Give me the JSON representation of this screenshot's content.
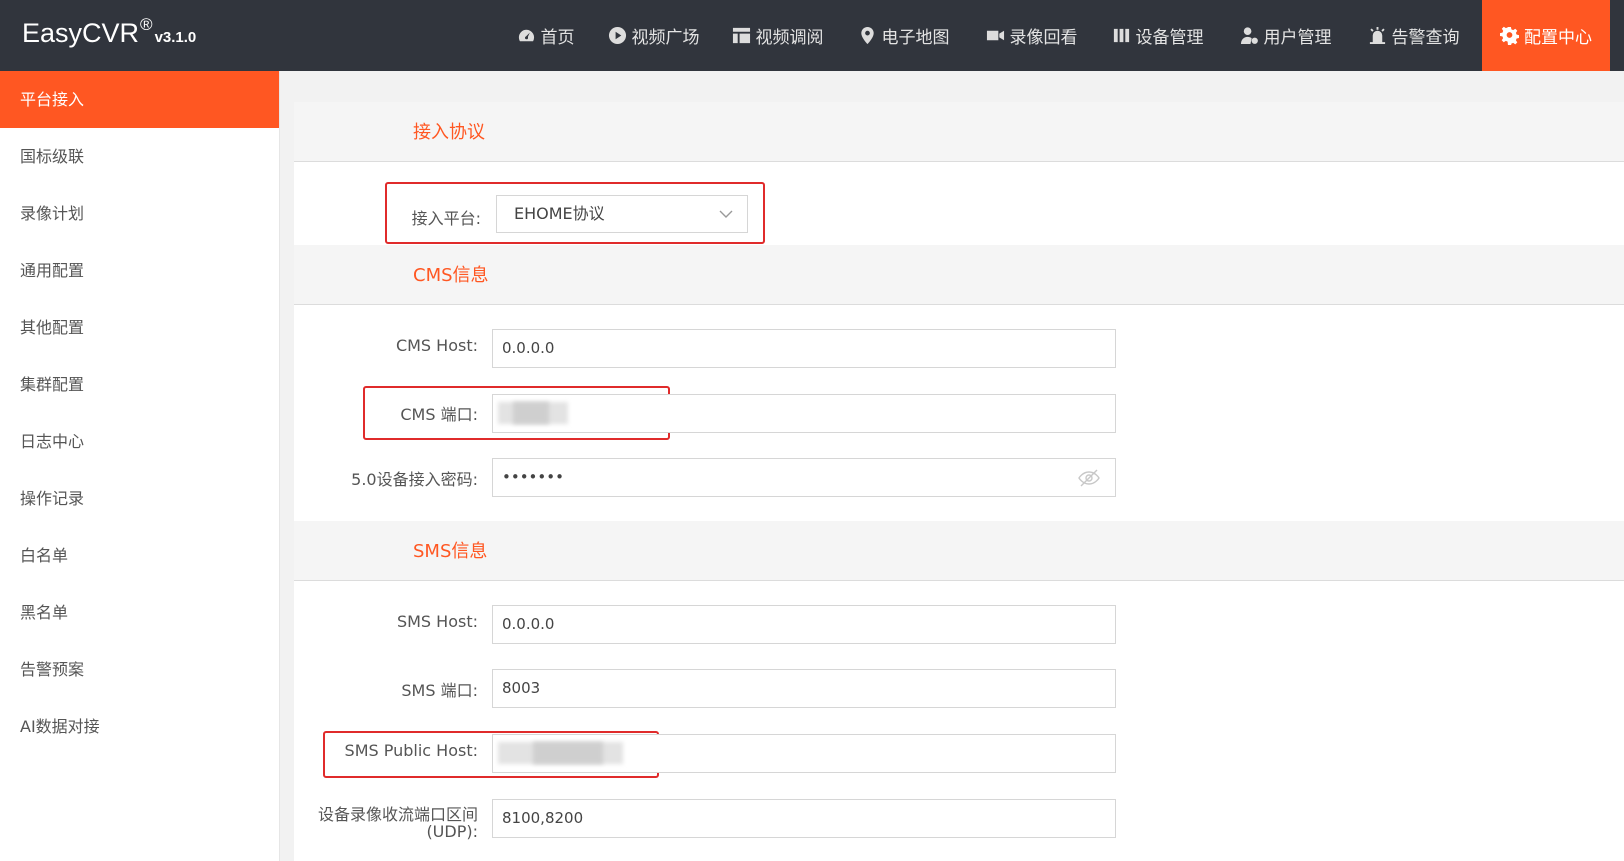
{
  "brand": {
    "name": "EasyCVR",
    "reg": "®",
    "version": "v3.1.0"
  },
  "nav": [
    {
      "label": "首页",
      "icon": "dashboard-icon"
    },
    {
      "label": "视频广场",
      "icon": "play-circle-icon"
    },
    {
      "label": "视频调阅",
      "icon": "layout-icon"
    },
    {
      "label": "电子地图",
      "icon": "map-pin-icon"
    },
    {
      "label": "录像回看",
      "icon": "video-camera-icon"
    },
    {
      "label": "设备管理",
      "icon": "device-icon"
    },
    {
      "label": "用户管理",
      "icon": "user-gear-icon"
    },
    {
      "label": "告警查询",
      "icon": "alarm-icon"
    },
    {
      "label": "配置中心",
      "icon": "gear-icon"
    }
  ],
  "sidebar": [
    {
      "label": "平台接入"
    },
    {
      "label": "国标级联"
    },
    {
      "label": "录像计划"
    },
    {
      "label": "通用配置"
    },
    {
      "label": "其他配置"
    },
    {
      "label": "集群配置"
    },
    {
      "label": "日志中心"
    },
    {
      "label": "操作记录"
    },
    {
      "label": "白名单"
    },
    {
      "label": "黑名单"
    },
    {
      "label": "告警预案"
    },
    {
      "label": "AI数据对接"
    }
  ],
  "sections": {
    "protocol": "接入协议",
    "cms": "CMS信息",
    "sms": "SMS信息"
  },
  "fields": {
    "platform": {
      "label": "接入平台:",
      "value": "EHOME协议"
    },
    "cms_host": {
      "label": "CMS Host:",
      "value": "0.0.0.0"
    },
    "cms_port": {
      "label": "CMS 端口:",
      "value": ""
    },
    "password": {
      "label": "5.0设备接入密码:",
      "value": "•••••••"
    },
    "sms_host": {
      "label": "SMS Host:",
      "value": "0.0.0.0"
    },
    "sms_port": {
      "label": "SMS 端口:",
      "value": "8003"
    },
    "sms_public_host": {
      "label": "SMS Public Host:",
      "value": ""
    },
    "recv_port_range": {
      "label": "设备录像收流端口区间",
      "label2": "(UDP):",
      "value": "8100,8200"
    }
  },
  "colors": {
    "accent": "#ff5722",
    "topbar": "#31353d",
    "highlight": "#e02b2b"
  }
}
